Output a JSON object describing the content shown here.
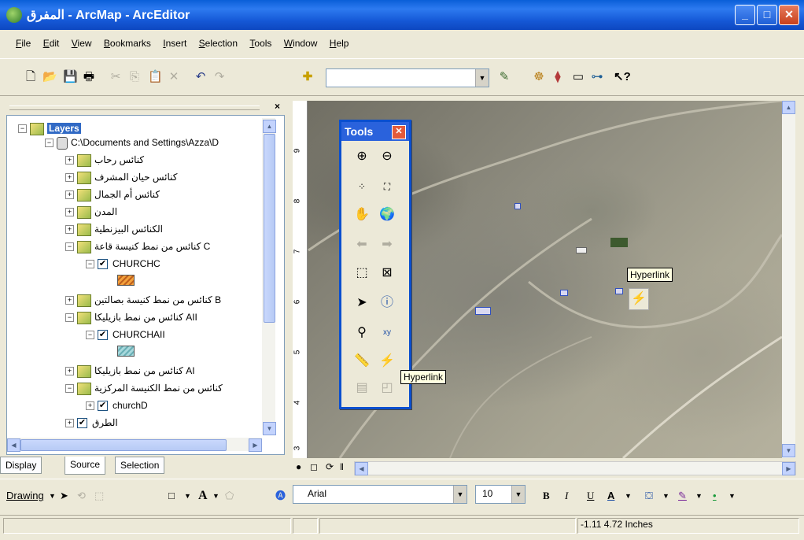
{
  "window": {
    "title": "المفرق - ArcMap - ArcEditor",
    "minimize": "_",
    "maximize": "□",
    "close": "✕"
  },
  "menu": [
    "File",
    "Edit",
    "View",
    "Bookmarks",
    "Insert",
    "Selection",
    "Tools",
    "Window",
    "Help"
  ],
  "toc": {
    "close": "×",
    "root": "Layers",
    "source_path": "C:\\Documents and Settings\\Azza\\D",
    "items": [
      {
        "label": "كنائس رحاب",
        "expand": "+"
      },
      {
        "label": "كنائس حيان المشرف",
        "expand": "+"
      },
      {
        "label": "كنائس أم الجمال",
        "expand": "+"
      },
      {
        "label": "المدن",
        "expand": "+"
      },
      {
        "label": "الكنائس البيزنطية",
        "expand": "+"
      },
      {
        "label": "C كنائس من نمط كنيسة قاعة",
        "expand": "−"
      },
      {
        "label": "CHURCHC",
        "checked": "✔"
      },
      {
        "label": "B كنائس من نمط كنيسة بصالتين",
        "expand": "+"
      },
      {
        "label": "AII كنائس من نمط بازيليكا",
        "expand": "−"
      },
      {
        "label": "CHURCHAII",
        "checked": "✔"
      },
      {
        "label": "AI كنائس من نمط بازيليكا",
        "expand": "+"
      },
      {
        "label": "كنائس من نمط الكنيسة المركزية",
        "expand": "−"
      },
      {
        "label": "churchD",
        "checked": "✔"
      },
      {
        "label": "الطرق",
        "checked": "✔"
      }
    ],
    "tabs": [
      "Display",
      "Source",
      "Selection"
    ]
  },
  "tools_panel": {
    "title": "Tools",
    "close": "✕"
  },
  "tooltips": {
    "map_hyperlink": "Hyperlink",
    "tool_hyperlink": "Hyperlink"
  },
  "ruler": [
    "9",
    "8",
    "7",
    "6",
    "5",
    "4",
    "3"
  ],
  "drawing_toolbar": {
    "drawing_label": "Drawing",
    "font": "Arial",
    "size": "10",
    "bold": "B",
    "italic": "I",
    "underline": "U"
  },
  "status": {
    "coordinates": "-1.11  4.72 Inches"
  },
  "colors": {
    "title_bar": "#0a5fd8",
    "tools_border": "#0a4fcf",
    "tooltip_bg": "#ffffe1"
  }
}
